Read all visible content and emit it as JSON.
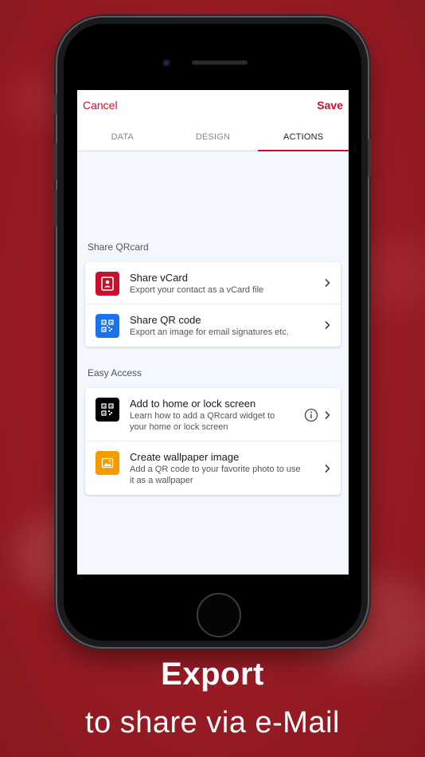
{
  "nav": {
    "cancel": "Cancel",
    "save": "Save"
  },
  "tabs": [
    {
      "label": "DATA",
      "active": false
    },
    {
      "label": "DESIGN",
      "active": false
    },
    {
      "label": "ACTIONS",
      "active": true
    }
  ],
  "share_section": {
    "title": "Share QRcard",
    "items": [
      {
        "title": "Share vCard",
        "subtitle": "Export your contact as a vCard file",
        "icon": "contact-card-icon",
        "icon_color": "#c8102e"
      },
      {
        "title": "Share QR code",
        "subtitle": "Export an image for email signatures etc.",
        "icon": "qr-code-icon",
        "icon_color": "#1a73e8"
      }
    ]
  },
  "access_section": {
    "title": "Easy Access",
    "items": [
      {
        "title": "Add to home or lock screen",
        "subtitle": "Learn how to add a QRcard widget to your home or lock screen",
        "icon": "qr-code-icon",
        "icon_color": "#000000"
      },
      {
        "title": "Create wallpaper image",
        "subtitle": "Add a QR code to your favorite photo to use it as a wallpaper",
        "icon": "image-icon",
        "icon_color": "#f59b00"
      }
    ]
  },
  "headline": "Export",
  "subline": "to share via e-Mail",
  "colors": {
    "accent": "#c8102e",
    "background": "#9b1c24"
  }
}
